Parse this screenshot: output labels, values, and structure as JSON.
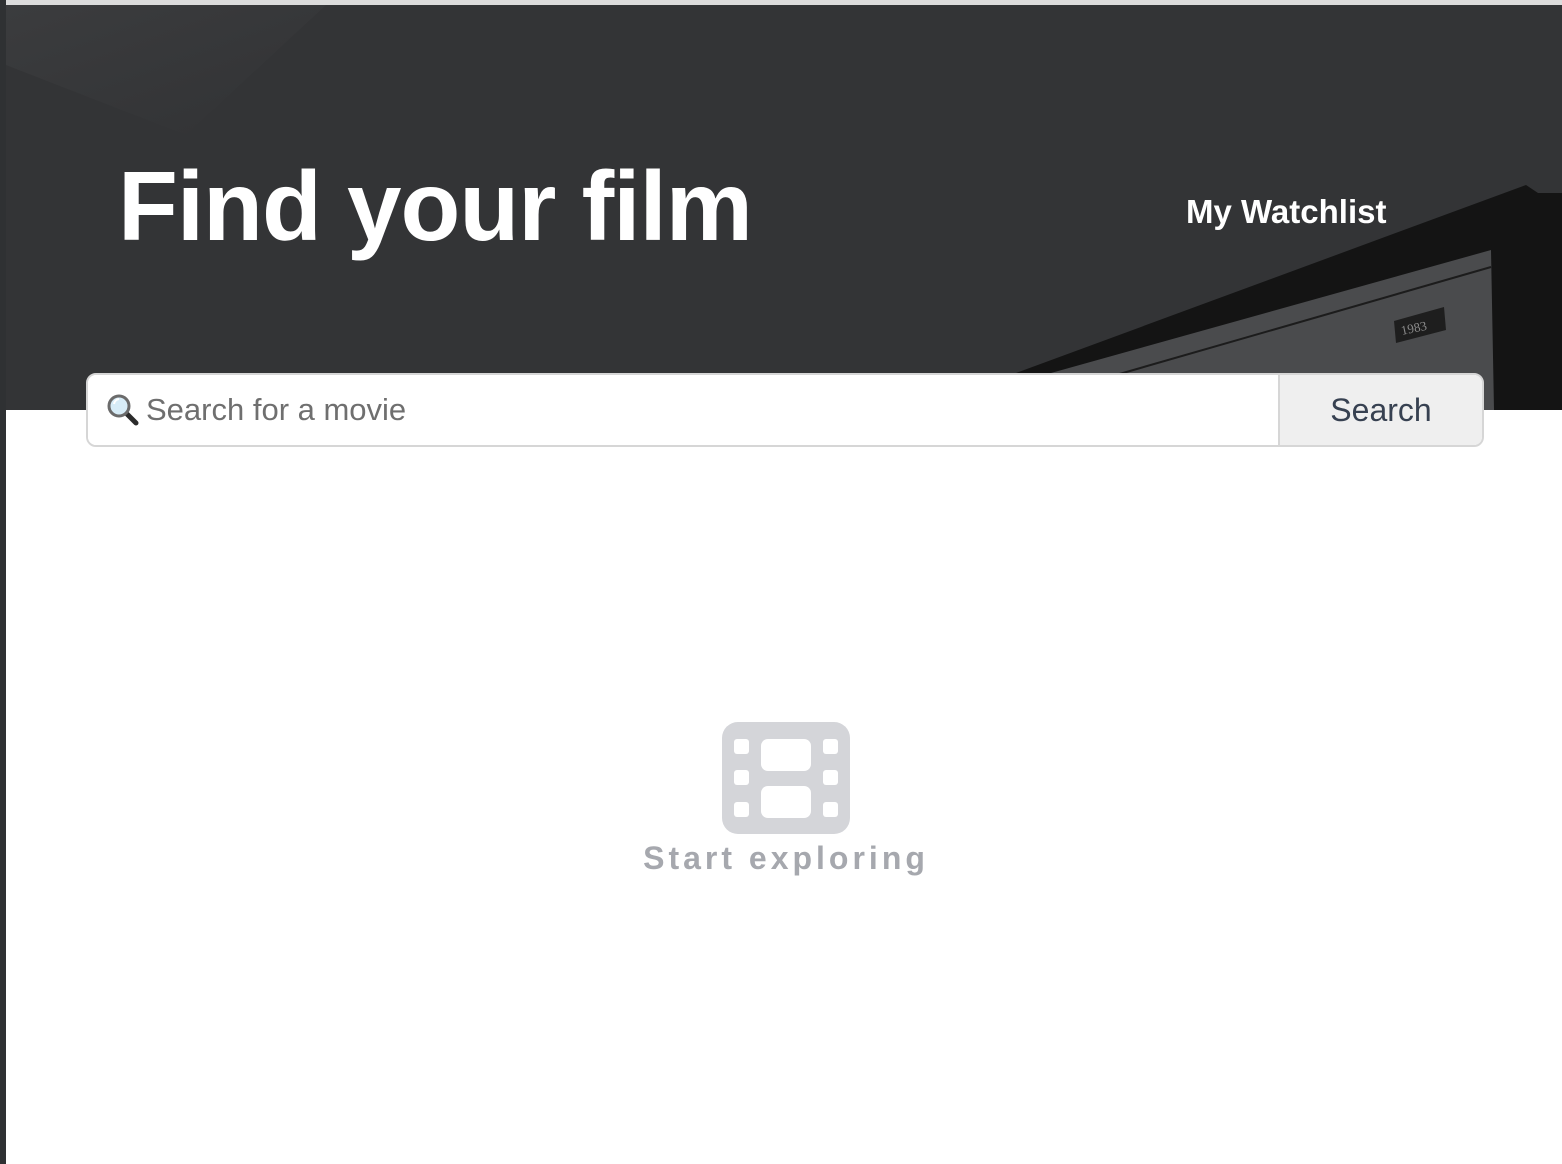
{
  "hero": {
    "title": "Find your film",
    "poster_year": "1983"
  },
  "nav": {
    "watchlist_label": "My Watchlist"
  },
  "search": {
    "placeholder": "Search for a movie",
    "value": "",
    "button_label": "Search",
    "icon": "search-icon"
  },
  "empty_state": {
    "icon": "film-icon",
    "text": "Start exploring"
  },
  "colors": {
    "hero_background": "#333436",
    "title_text": "#ffffff",
    "button_background": "#efefef",
    "button_text": "#374151",
    "empty_icon": "#d4d5d9",
    "empty_text": "#a6a8ae"
  }
}
